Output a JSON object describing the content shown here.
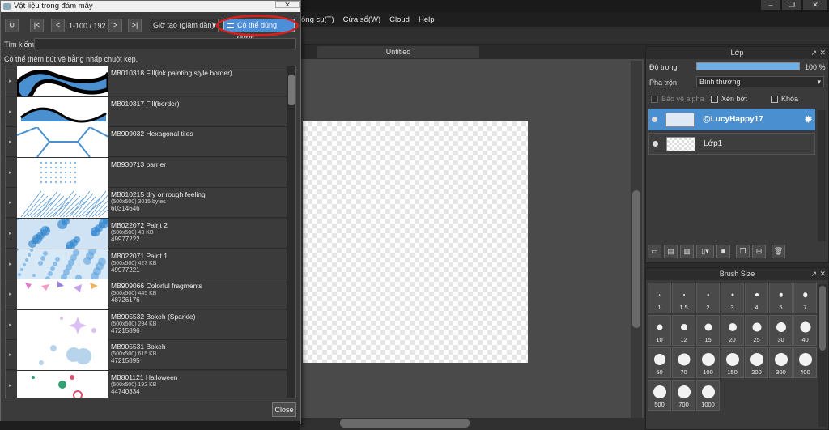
{
  "menubar": {
    "items": [
      "ông cụ(T)",
      "Cửa sổ(W)",
      "Cloud",
      "Help"
    ]
  },
  "window_controls": {
    "minimize": "–",
    "restore": "❐",
    "close": "✕"
  },
  "canvas": {
    "tab_title": "Untitled"
  },
  "layer_panel": {
    "title": "Lớp",
    "opacity_label": "Độ trong",
    "opacity_value": "100 %",
    "opacity_fraction": 1.0,
    "blend_label": "Pha trộn",
    "blend_value": "Bình thường",
    "checkboxes": [
      "Bảo vệ alpha",
      "Xén bớt",
      "Khóa"
    ],
    "layers": [
      {
        "name": "@LucyHappy17",
        "selected": true
      },
      {
        "name": "Lớp1",
        "selected": false
      }
    ],
    "tool_icons": [
      "new-layer-icon",
      "new-layer-2-icon",
      "new-layer-3-icon",
      "add-layer-menu-icon",
      "folder-icon",
      "duplicate-icon",
      "merge-icon",
      "delete-icon"
    ]
  },
  "brush_panel": {
    "title": "Brush Size",
    "sizes": [
      "1",
      "1.5",
      "2",
      "3",
      "4",
      "5",
      "7",
      "10",
      "12",
      "15",
      "20",
      "25",
      "30",
      "40",
      "50",
      "70",
      "100",
      "150",
      "200",
      "300",
      "400",
      "500",
      "700",
      "1000"
    ]
  },
  "dialog": {
    "title": "Vật liệu trong đám mây",
    "close_x": "✕",
    "page_info": "1-100 / 192",
    "sort_value": "Giờ tạo (giảm dần)",
    "usable_button": "Có thể dùng được",
    "search_label": "Tìm kiếm:",
    "search_value": "",
    "hint": "Có thể thêm bút vẽ bằng nhấp chuột kép.",
    "close_button": "Close",
    "materials": [
      {
        "name": "MB010318 Fill(ink painting style border)",
        "size": "",
        "id": "",
        "thumb": "ink-wave"
      },
      {
        "name": "MB010317 Fill(border)",
        "size": "",
        "id": "",
        "thumb": "border-wave"
      },
      {
        "name": "MB909032 Hexagonal tiles",
        "size": "",
        "id": "",
        "thumb": "hex"
      },
      {
        "name": "MB930713 barrier",
        "size": "",
        "id": "",
        "thumb": "barrier"
      },
      {
        "name": "MB010215 dry or rough feeling",
        "size": "(500x500) 3015 bytes",
        "id": "60314646",
        "thumb": "rough"
      },
      {
        "name": "MB022072 Paint 2",
        "size": "(500x500) 43 KB",
        "id": "49977222",
        "thumb": "paint2"
      },
      {
        "name": "MB022071 Paint 1",
        "size": "(500x500) 427 KB",
        "id": "49977221",
        "thumb": "paint1"
      },
      {
        "name": "MB909066 Colorful fragments",
        "size": "(500x500) 445 KB",
        "id": "48726176",
        "thumb": "fragments"
      },
      {
        "name": "MB905532 Bokeh (Sparkle)",
        "size": "(500x500) 294 KB",
        "id": "47215896",
        "thumb": "sparkle"
      },
      {
        "name": "MB905531 Bokeh",
        "size": "(500x500) 615 KB",
        "id": "47215895",
        "thumb": "bokeh"
      },
      {
        "name": "MB801121 Halloween",
        "size": "(500x500) 192 KB",
        "id": "44740834",
        "thumb": "halloween"
      }
    ]
  }
}
